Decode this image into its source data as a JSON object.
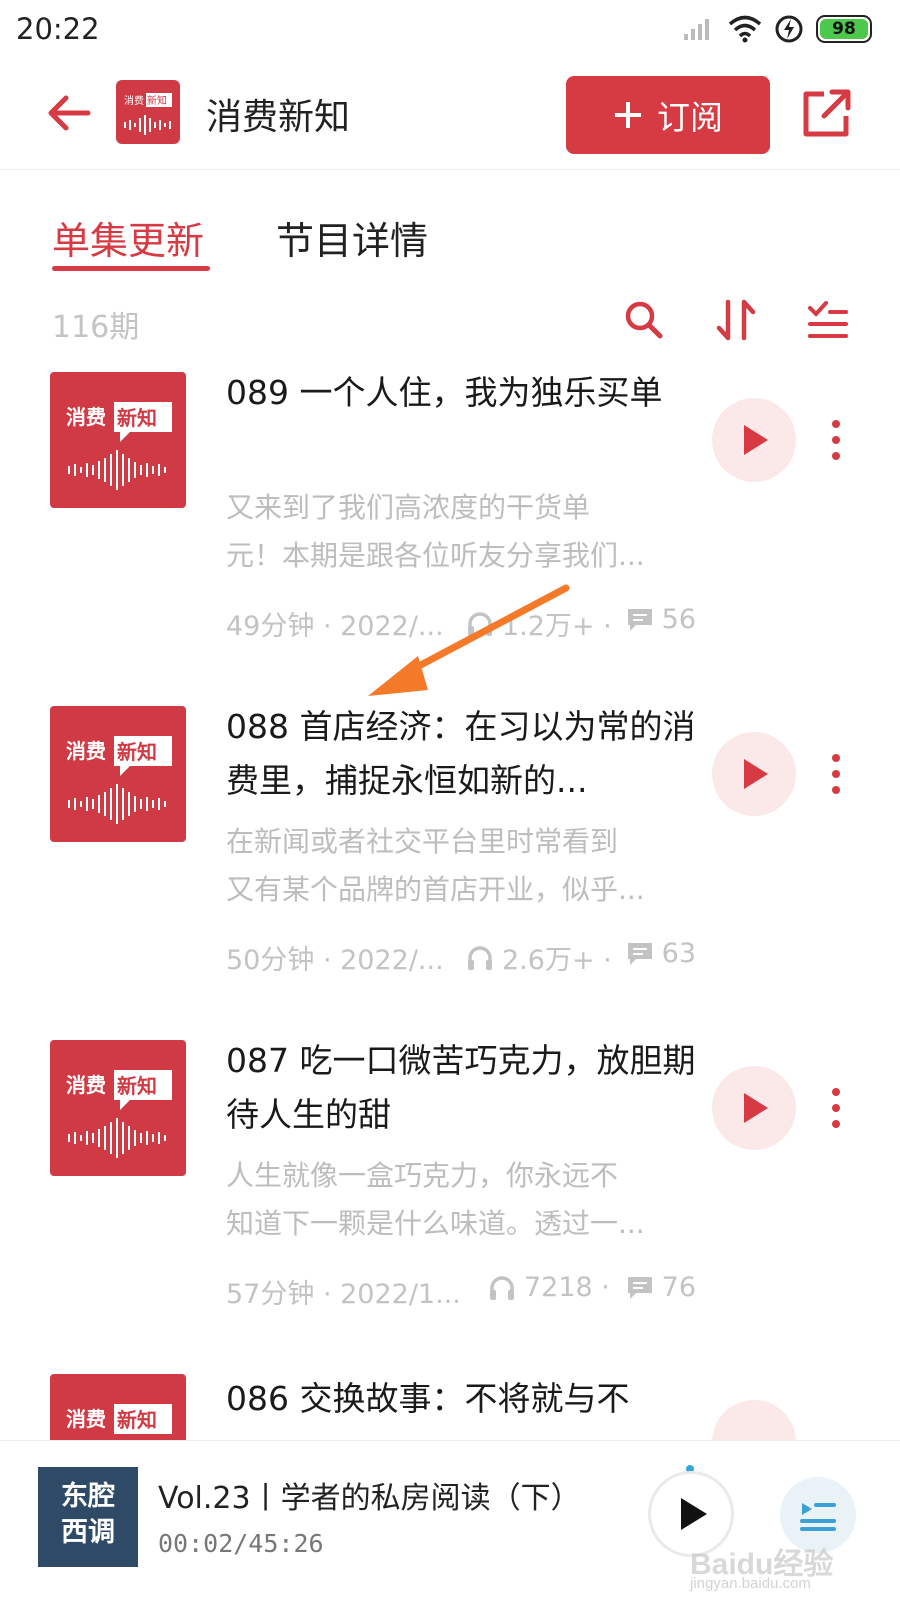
{
  "status_bar": {
    "time": "20:22",
    "battery": "98"
  },
  "header": {
    "title": "消费新知",
    "subscribe_label": "订阅"
  },
  "tabs": [
    {
      "label": "单集更新",
      "active": true
    },
    {
      "label": "节目详情",
      "active": false
    }
  ],
  "list": {
    "count": "116期"
  },
  "cover_art": {
    "line1": "消费",
    "line2": "新知"
  },
  "episodes": [
    {
      "title": "089 一个人住，我为独乐买单",
      "desc_line1": "又来到了我们高浓度的干货单",
      "desc_line2": "元！本期是跟各位听友分享我们...",
      "duration_date": "49分钟 · 2022/...",
      "plays": "1.2万+ ·",
      "comments": "56"
    },
    {
      "title": "088 首店经济：在习以为常的消费里，捕捉永恒如新的...",
      "desc_line1": "在新闻或者社交平台里时常看到",
      "desc_line2": "又有某个品牌的首店开业，似乎...",
      "duration_date": "50分钟 · 2022/...",
      "plays": "2.6万+ ·",
      "comments": "63"
    },
    {
      "title": "087 吃一口微苦巧克力，放胆期待人生的甜",
      "desc_line1": "人生就像一盒巧克力，你永远不",
      "desc_line2": "知道下一颗是什么味道。透过一...",
      "duration_date": "57分钟 · 2022/1...",
      "plays": "7218 ·",
      "comments": "76"
    },
    {
      "title": "086 交换故事：不将就与不",
      "desc_line1": "",
      "desc_line2": "",
      "duration_date": "",
      "plays": "",
      "comments": ""
    }
  ],
  "player": {
    "cover_line1": "东腔",
    "cover_line2": "西调",
    "title": "Vol.23丨学者的私房阅读（下）",
    "time": "00:02/45:26"
  },
  "watermark": {
    "main": "Baidu经验",
    "sub": "jingyan.baidu.com"
  },
  "colors": {
    "accent": "#d63a43",
    "play_bg": "#fbe9ea",
    "annotation": "#f47a2a"
  }
}
